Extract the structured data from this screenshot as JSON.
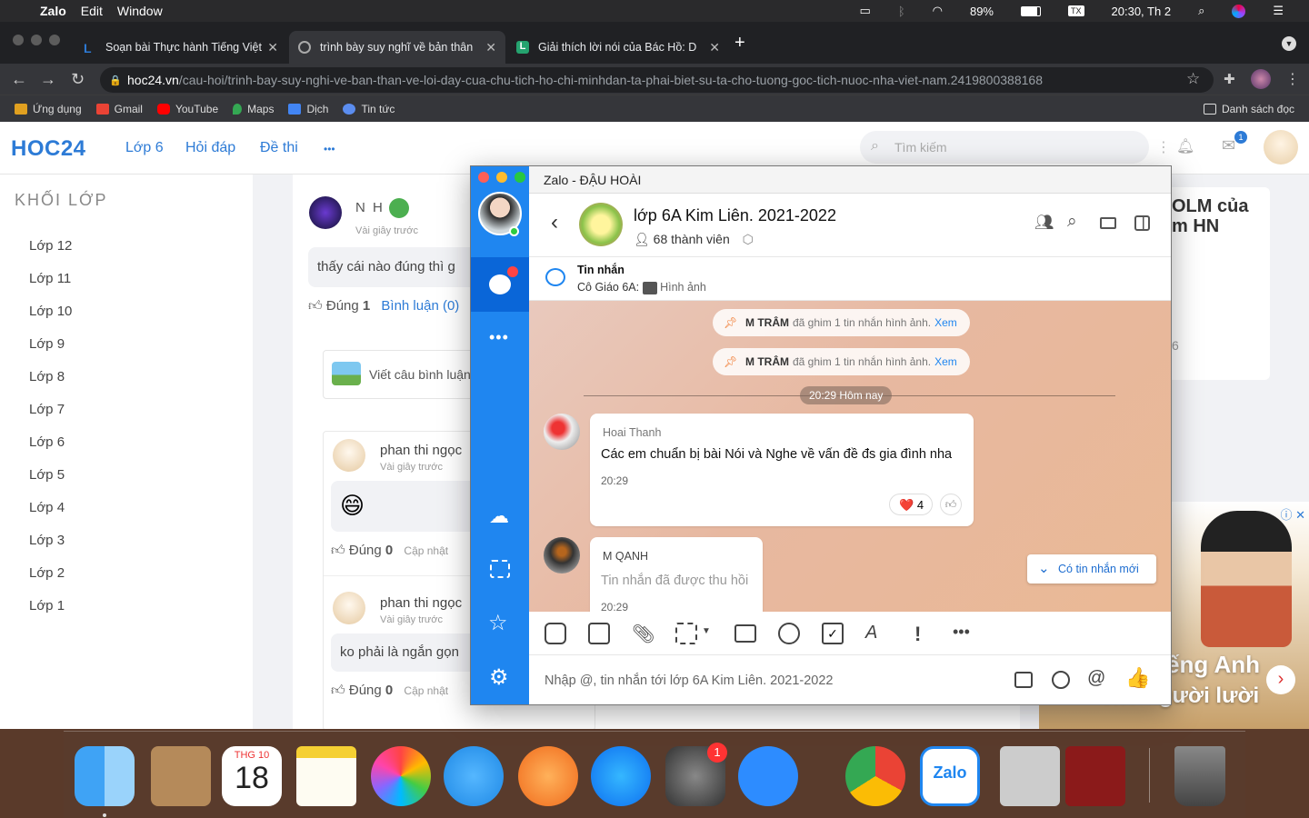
{
  "menubar": {
    "app": "Zalo",
    "edit": "Edit",
    "window": "Window",
    "battery": "89%",
    "clock": "20:30, Th 2"
  },
  "browser": {
    "tabs": [
      {
        "label": "Soạn bài Thực hành Tiếng Việt",
        "close": "✕"
      },
      {
        "label": "trình bày suy nghĩ về bản thân",
        "close": "✕"
      },
      {
        "label": "Giải thích lời nói của Bác Hồ: D",
        "close": "✕"
      }
    ],
    "new_tab": "+",
    "url_host": "hoc24.vn",
    "url_path": "/cau-hoi/trinh-bay-suy-nghi-ve-ban-than-ve-loi-day-cua-chu-tich-ho-chi-minhdan-ta-phai-biet-su-ta-cho-tuong-goc-tich-nuoc-nha-viet-nam.2419800388168",
    "bookmarks": [
      {
        "label": "Ứng dụng",
        "color": "#e0a020"
      },
      {
        "label": "Gmail",
        "color": "#ea4335"
      },
      {
        "label": "YouTube",
        "color": "#ff0000"
      },
      {
        "label": "Maps",
        "color": "#34a853"
      },
      {
        "label": "Dịch",
        "color": "#4285f4"
      },
      {
        "label": "Tin tức",
        "color": "#5b8def"
      }
    ],
    "reading_list": "Danh sách đọc"
  },
  "site": {
    "logo": "HOC24",
    "nav": [
      "Lớp 6",
      "Hỏi đáp",
      "Đề thi",
      "•••"
    ],
    "search_placeholder": "Tìm kiếm",
    "mail_badge": "1",
    "side_title": "KHỐI LỚP",
    "grades": [
      "Lớp 12",
      "Lớp 11",
      "Lớp 10",
      "Lớp 9",
      "Lớp 8",
      "Lớp 7",
      "Lớp 6",
      "Lớp 5",
      "Lớp 4",
      "Lớp 3",
      "Lớp 2",
      "Lớp 1"
    ],
    "answer": {
      "user": "N H",
      "time": "Vài giây trước",
      "text": "thấy cái nào đúng thì g",
      "correct_label": "Đúng",
      "correct_count": "1",
      "comment_link": "Bình luận (0)"
    },
    "comment_box": "Viết câu bình luận",
    "comments": [
      {
        "user": "phan thi ngọc",
        "time": "Vài giây trước",
        "text": "😄",
        "correct_label": "Đúng",
        "count": "0",
        "update": "Cập nhật"
      },
      {
        "user": "phan thi ngọc",
        "time": "Vài giây trước",
        "text": "ko phải là ngắn gọn",
        "correct_label": "Đúng",
        "count": "0",
        "update": "Cập nhật"
      }
    ],
    "right_title_1": "OLM của",
    "right_title_2": "m HN",
    "right_number": "6",
    "ad_text_1": "ếng Anh",
    "ad_text_2": "cho người lười",
    "ad_badge": "ⓘ ✕"
  },
  "zalo": {
    "window_title": "Zalo - ĐẬU HOÀI",
    "group_name": "lớp 6A Kim Liên. 2021-2022",
    "members": "68 thành viên",
    "pin_title": "Tin nhắn",
    "pin_sender": "Cô Giáo 6A:",
    "pin_content": "Hình ảnh",
    "pinned": [
      {
        "who": "M TRÂM",
        "text": "đã ghim 1 tin nhắn hình ảnh.",
        "link": "Xem"
      },
      {
        "who": "M TRÂM",
        "text": "đã ghim 1 tin nhắn hình ảnh.",
        "link": "Xem"
      }
    ],
    "date_divider": "20:29 Hôm nay",
    "messages": [
      {
        "sender": "Hoai Thanh",
        "text": "Các em chuẩn bị bài Nói và Nghe  về vấn đề đs gia đình nha",
        "time": "20:29",
        "reaction": "❤️",
        "reaction_count": "4"
      },
      {
        "sender": "M QANH",
        "text": "Tin nhắn đã được thu hồi",
        "time": "20:29"
      }
    ],
    "new_msg": "Có tin nhắn mới",
    "input_placeholder": "Nhập @, tin nhắn tới lớp 6A Kim Liên. 2021-2022"
  },
  "dock": {
    "calendar_month": "THG 10",
    "calendar_day": "18",
    "settings_badge": "1",
    "zalo_label": "Zalo"
  }
}
